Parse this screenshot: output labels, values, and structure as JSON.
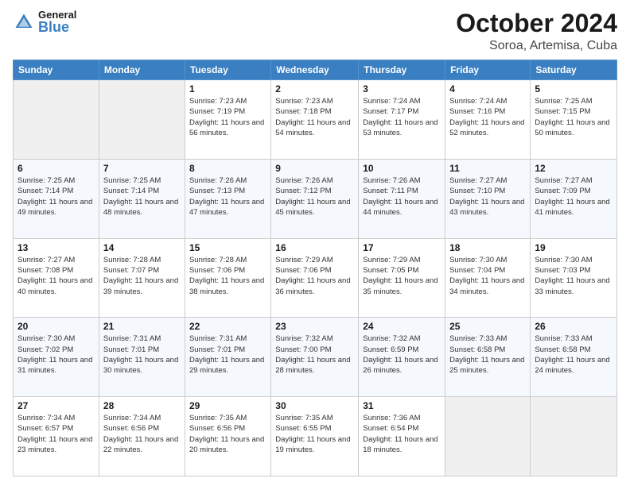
{
  "header": {
    "logo": {
      "general": "General",
      "blue": "Blue",
      "icon": "▶"
    },
    "month": "October 2024",
    "location": "Soroa, Artemisa, Cuba"
  },
  "weekdays": [
    "Sunday",
    "Monday",
    "Tuesday",
    "Wednesday",
    "Thursday",
    "Friday",
    "Saturday"
  ],
  "weeks": [
    [
      {
        "day": "",
        "sunrise": "",
        "sunset": "",
        "daylight": ""
      },
      {
        "day": "",
        "sunrise": "",
        "sunset": "",
        "daylight": ""
      },
      {
        "day": "1",
        "sunrise": "Sunrise: 7:23 AM",
        "sunset": "Sunset: 7:19 PM",
        "daylight": "Daylight: 11 hours and 56 minutes."
      },
      {
        "day": "2",
        "sunrise": "Sunrise: 7:23 AM",
        "sunset": "Sunset: 7:18 PM",
        "daylight": "Daylight: 11 hours and 54 minutes."
      },
      {
        "day": "3",
        "sunrise": "Sunrise: 7:24 AM",
        "sunset": "Sunset: 7:17 PM",
        "daylight": "Daylight: 11 hours and 53 minutes."
      },
      {
        "day": "4",
        "sunrise": "Sunrise: 7:24 AM",
        "sunset": "Sunset: 7:16 PM",
        "daylight": "Daylight: 11 hours and 52 minutes."
      },
      {
        "day": "5",
        "sunrise": "Sunrise: 7:25 AM",
        "sunset": "Sunset: 7:15 PM",
        "daylight": "Daylight: 11 hours and 50 minutes."
      }
    ],
    [
      {
        "day": "6",
        "sunrise": "Sunrise: 7:25 AM",
        "sunset": "Sunset: 7:14 PM",
        "daylight": "Daylight: 11 hours and 49 minutes."
      },
      {
        "day": "7",
        "sunrise": "Sunrise: 7:25 AM",
        "sunset": "Sunset: 7:14 PM",
        "daylight": "Daylight: 11 hours and 48 minutes."
      },
      {
        "day": "8",
        "sunrise": "Sunrise: 7:26 AM",
        "sunset": "Sunset: 7:13 PM",
        "daylight": "Daylight: 11 hours and 47 minutes."
      },
      {
        "day": "9",
        "sunrise": "Sunrise: 7:26 AM",
        "sunset": "Sunset: 7:12 PM",
        "daylight": "Daylight: 11 hours and 45 minutes."
      },
      {
        "day": "10",
        "sunrise": "Sunrise: 7:26 AM",
        "sunset": "Sunset: 7:11 PM",
        "daylight": "Daylight: 11 hours and 44 minutes."
      },
      {
        "day": "11",
        "sunrise": "Sunrise: 7:27 AM",
        "sunset": "Sunset: 7:10 PM",
        "daylight": "Daylight: 11 hours and 43 minutes."
      },
      {
        "day": "12",
        "sunrise": "Sunrise: 7:27 AM",
        "sunset": "Sunset: 7:09 PM",
        "daylight": "Daylight: 11 hours and 41 minutes."
      }
    ],
    [
      {
        "day": "13",
        "sunrise": "Sunrise: 7:27 AM",
        "sunset": "Sunset: 7:08 PM",
        "daylight": "Daylight: 11 hours and 40 minutes."
      },
      {
        "day": "14",
        "sunrise": "Sunrise: 7:28 AM",
        "sunset": "Sunset: 7:07 PM",
        "daylight": "Daylight: 11 hours and 39 minutes."
      },
      {
        "day": "15",
        "sunrise": "Sunrise: 7:28 AM",
        "sunset": "Sunset: 7:06 PM",
        "daylight": "Daylight: 11 hours and 38 minutes."
      },
      {
        "day": "16",
        "sunrise": "Sunrise: 7:29 AM",
        "sunset": "Sunset: 7:06 PM",
        "daylight": "Daylight: 11 hours and 36 minutes."
      },
      {
        "day": "17",
        "sunrise": "Sunrise: 7:29 AM",
        "sunset": "Sunset: 7:05 PM",
        "daylight": "Daylight: 11 hours and 35 minutes."
      },
      {
        "day": "18",
        "sunrise": "Sunrise: 7:30 AM",
        "sunset": "Sunset: 7:04 PM",
        "daylight": "Daylight: 11 hours and 34 minutes."
      },
      {
        "day": "19",
        "sunrise": "Sunrise: 7:30 AM",
        "sunset": "Sunset: 7:03 PM",
        "daylight": "Daylight: 11 hours and 33 minutes."
      }
    ],
    [
      {
        "day": "20",
        "sunrise": "Sunrise: 7:30 AM",
        "sunset": "Sunset: 7:02 PM",
        "daylight": "Daylight: 11 hours and 31 minutes."
      },
      {
        "day": "21",
        "sunrise": "Sunrise: 7:31 AM",
        "sunset": "Sunset: 7:01 PM",
        "daylight": "Daylight: 11 hours and 30 minutes."
      },
      {
        "day": "22",
        "sunrise": "Sunrise: 7:31 AM",
        "sunset": "Sunset: 7:01 PM",
        "daylight": "Daylight: 11 hours and 29 minutes."
      },
      {
        "day": "23",
        "sunrise": "Sunrise: 7:32 AM",
        "sunset": "Sunset: 7:00 PM",
        "daylight": "Daylight: 11 hours and 28 minutes."
      },
      {
        "day": "24",
        "sunrise": "Sunrise: 7:32 AM",
        "sunset": "Sunset: 6:59 PM",
        "daylight": "Daylight: 11 hours and 26 minutes."
      },
      {
        "day": "25",
        "sunrise": "Sunrise: 7:33 AM",
        "sunset": "Sunset: 6:58 PM",
        "daylight": "Daylight: 11 hours and 25 minutes."
      },
      {
        "day": "26",
        "sunrise": "Sunrise: 7:33 AM",
        "sunset": "Sunset: 6:58 PM",
        "daylight": "Daylight: 11 hours and 24 minutes."
      }
    ],
    [
      {
        "day": "27",
        "sunrise": "Sunrise: 7:34 AM",
        "sunset": "Sunset: 6:57 PM",
        "daylight": "Daylight: 11 hours and 23 minutes."
      },
      {
        "day": "28",
        "sunrise": "Sunrise: 7:34 AM",
        "sunset": "Sunset: 6:56 PM",
        "daylight": "Daylight: 11 hours and 22 minutes."
      },
      {
        "day": "29",
        "sunrise": "Sunrise: 7:35 AM",
        "sunset": "Sunset: 6:56 PM",
        "daylight": "Daylight: 11 hours and 20 minutes."
      },
      {
        "day": "30",
        "sunrise": "Sunrise: 7:35 AM",
        "sunset": "Sunset: 6:55 PM",
        "daylight": "Daylight: 11 hours and 19 minutes."
      },
      {
        "day": "31",
        "sunrise": "Sunrise: 7:36 AM",
        "sunset": "Sunset: 6:54 PM",
        "daylight": "Daylight: 11 hours and 18 minutes."
      },
      {
        "day": "",
        "sunrise": "",
        "sunset": "",
        "daylight": ""
      },
      {
        "day": "",
        "sunrise": "",
        "sunset": "",
        "daylight": ""
      }
    ]
  ]
}
